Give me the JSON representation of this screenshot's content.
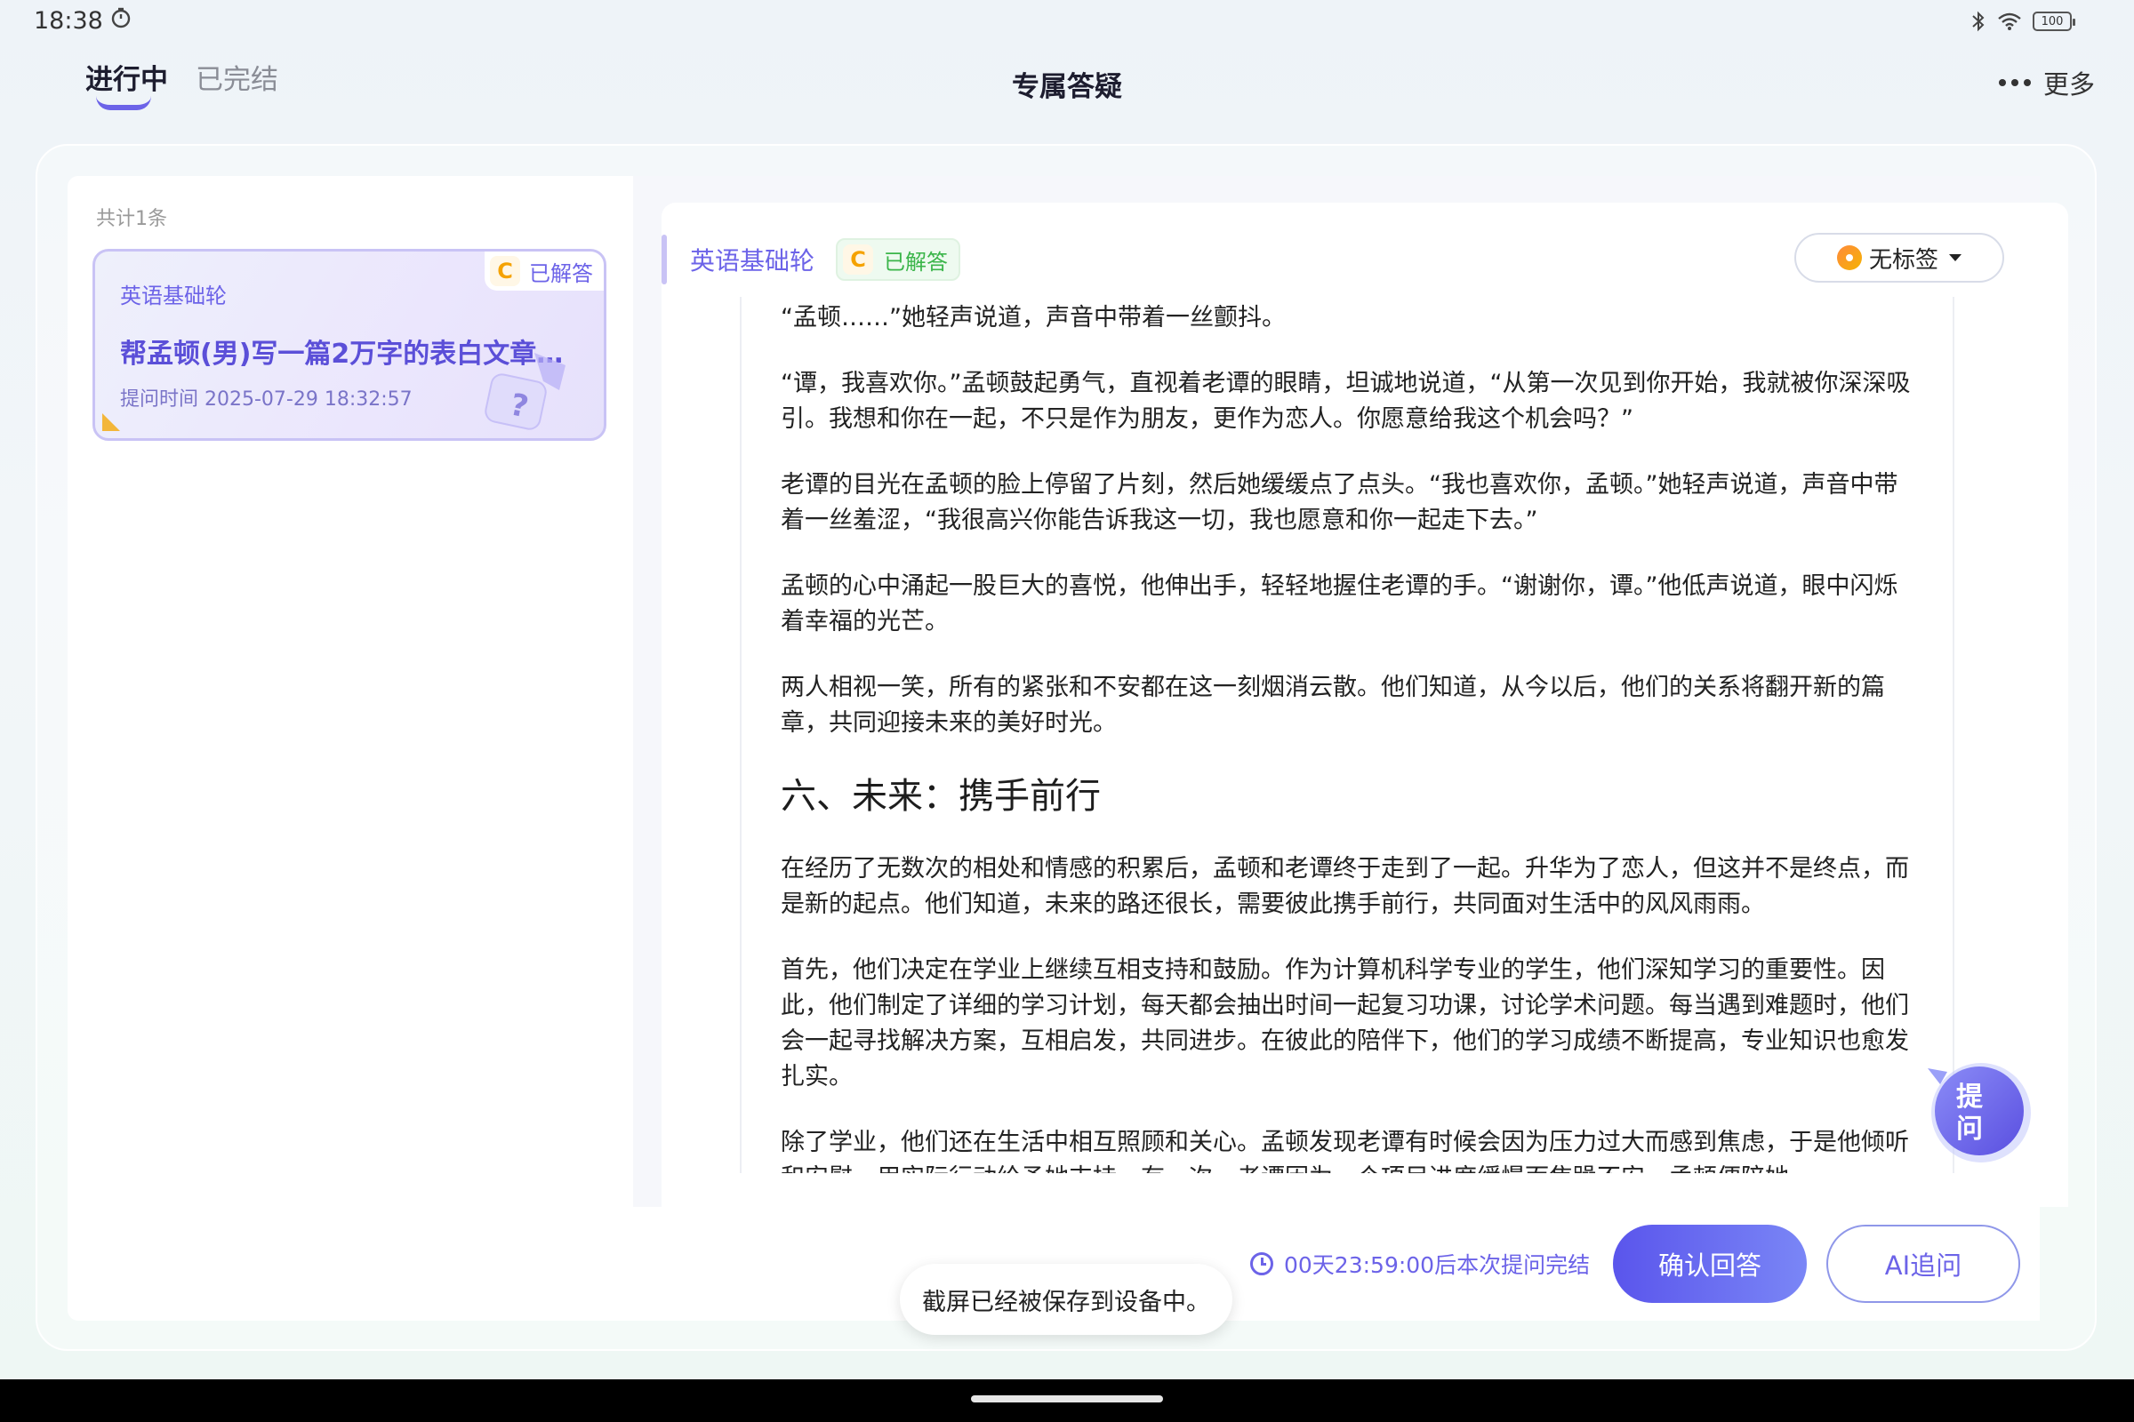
{
  "status_bar": {
    "time": "18:38",
    "battery": "100"
  },
  "tabs": {
    "active": "进行中",
    "inactive": "已完结"
  },
  "page_title": "专属答疑",
  "more_label": "更多",
  "list": {
    "count": "共计1条",
    "card": {
      "badge_letter": "C",
      "status": "已解答",
      "subject": "英语基础轮",
      "title": "帮孟顿(男)写一篇2万字的表白文章给…",
      "time": "提问时间 2025-07-29 18:32:57"
    }
  },
  "answer": {
    "subject": "英语基础轮",
    "badge_letter": "C",
    "status": "已解答",
    "tag_label": "无标签",
    "paragraphs": [
      "“孟顿……”她轻声说道，声音中带着一丝颤抖。",
      "“谭，我喜欢你。”孟顿鼓起勇气，直视着老谭的眼睛，坦诚地说道，“从第一次见到你开始，我就被你深深吸引。我想和你在一起，不只是作为朋友，更作为恋人。你愿意给我这个机会吗？”",
      "老谭的目光在孟顿的脸上停留了片刻，然后她缓缓点了点头。“我也喜欢你，孟顿。”她轻声说道，声音中带着一丝羞涩，“我很高兴你能告诉我这一切，我也愿意和你一起走下去。”",
      "孟顿的心中涌起一股巨大的喜悦，他伸出手，轻轻地握住老谭的手。“谢谢你，谭。”他低声说道，眼中闪烁着幸福的光芒。",
      "两人相视一笑，所有的紧张和不安都在这一刻烟消云散。他们知道，从今以后，他们的关系将翻开新的篇章，共同迎接未来的美好时光。"
    ],
    "heading": "六、未来：携手前行",
    "paragraphs2": [
      "在经历了无数次的相处和情感的积累后，孟顿和老谭终于走到了一起。升华为了恋人，但这并不是终点，而是新的起点。他们知道，未来的路还很长，需要彼此携手前行，共同面对生活中的风风雨雨。",
      "首先，他们决定在学业上继续互相支持和鼓励。作为计算机科学专业的学生，他们深知学习的重要性。因此，他们制定了详细的学习计划，每天都会抽出时间一起复习功课，讨论学术问题。每当遇到难题时，他们会一起寻找解决方案，互相启发，共同进步。在彼此的陪伴下，他们的学习成绩不断提高，专业知识也愈发扎实。",
      "除了学业，他们还在生活中相互照顾和关心。孟顿发现老谭有时候会因为压力过大而感到焦虑，于是他倾听和安慰，用实际行动给予她支持。有一次，老谭因为一个项目进度缓慢而焦躁不安，孟顿便陪她一"
    ],
    "float_button": "提问"
  },
  "bottom": {
    "countdown": "00天23:59:00后本次提问完结",
    "confirm_button": "确认回答",
    "ai_button": "AI追问"
  },
  "toast": "截屏已经被保存到设备中。",
  "colors": {
    "accent": "#6c63e8",
    "answered_green": "#3bb54a",
    "badge_orange": "#f5a200"
  }
}
